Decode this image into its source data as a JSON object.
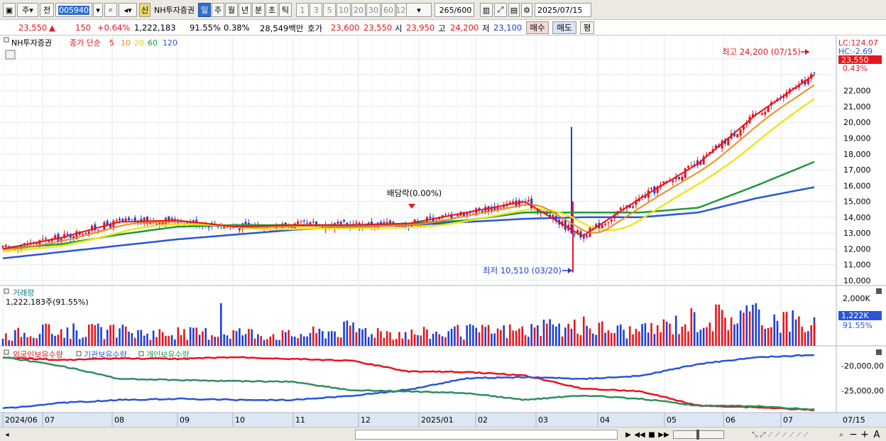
{
  "toolbar": {
    "menu_icon": "window-icon",
    "type_label": "주",
    "prev_label": "전",
    "code_value": "005940",
    "stock_name": "NH투자증권",
    "new_badge": "신",
    "periods": [
      "일",
      "주",
      "월",
      "년",
      "분",
      "초",
      "틱"
    ],
    "active_period": "일",
    "intervals": [
      "1",
      "3",
      "5",
      "10",
      "20",
      "30",
      "60",
      "120"
    ],
    "count": "265",
    "total": "/600",
    "date_value": "2025/07/15"
  },
  "quote": {
    "price": "23,550",
    "change_arrow": "▲",
    "change": "150",
    "change_pct": "+0.64%",
    "volume": "1,222,183",
    "volume_ratio": "91.55%",
    "turnover": "0.38%",
    "amount": "28,549백만",
    "ask_label": "호가",
    "ask": "23,600",
    "bid": "23,550",
    "open_label": "시",
    "open": "23,950",
    "high_label": "고",
    "high": "24,200",
    "low_label": "저",
    "low": "23,100",
    "buy_label": "매수",
    "sell_label": "매도",
    "eval_label": "평"
  },
  "price_panel": {
    "legend_name": "NH투자증권",
    "legend_ma_label": "종가 단순",
    "ma_periods": [
      "5",
      "10",
      "20",
      "60",
      "120"
    ],
    "ma_colors": [
      "#e8141c",
      "#f08c1c",
      "#f0e61c",
      "#1f9a3a",
      "#2a55d8"
    ],
    "axis_labels": [
      "22,000",
      "21,000",
      "20,000",
      "19,000",
      "18,000",
      "17,000",
      "16,000",
      "15,000",
      "14,000",
      "13,000",
      "12,000",
      "11,000",
      "10,000"
    ],
    "lc": "LC:124.07",
    "hc": "HC:-2.69",
    "last_price_tag": "23,550",
    "last_pct": "0.43%",
    "high_note": "최고 24,200 (07/15)",
    "low_note": "최저 10,510 (03/20)",
    "dividend_note": "배당락(0.00%)"
  },
  "volume_panel": {
    "title": "거래량",
    "value_note": "1,222,183주(91.55%)",
    "axis_label": "2,000K",
    "tag": "1,222K",
    "tag_pct": "91.55%"
  },
  "holding_panel": {
    "series": [
      {
        "name": "외국인보유수량",
        "color": "#e8141c"
      },
      {
        "name": "기관보유수량",
        "color": "#2a55d8"
      },
      {
        "name": "개인보유수량",
        "color": "#2f8f5a"
      }
    ],
    "axis_labels": [
      "-20,000,00",
      "-25,000,00"
    ]
  },
  "x_axis": {
    "labels": [
      "2024/06",
      "07",
      "08",
      "09",
      "10",
      "11",
      "12",
      "2025/01",
      "02",
      "03",
      "04",
      "05",
      "06",
      "07"
    ],
    "right_label": "07/15"
  },
  "chart_data": [
    {
      "type": "line",
      "title": "NH투자증권",
      "ylim": [
        10000,
        24500
      ],
      "note": "candlestick price with simple moving averages",
      "x": [
        "2024/06",
        "07",
        "08",
        "09",
        "10",
        "11",
        "12",
        "2025/01",
        "02",
        "03",
        "04",
        "05",
        "06",
        "07",
        "07/15"
      ],
      "series": [
        {
          "name": "5",
          "values": [
            12000,
            12700,
            13700,
            13800,
            13400,
            13500,
            13500,
            13600,
            14300,
            15000,
            12800,
            15200,
            17400,
            20500,
            23000
          ]
        },
        {
          "name": "60",
          "values": [
            12000,
            12300,
            12900,
            13400,
            13500,
            13500,
            13500,
            13600,
            13800,
            14300,
            14300,
            14300,
            14600,
            16000,
            17500
          ]
        },
        {
          "name": "120",
          "values": [
            11400,
            11800,
            12200,
            12600,
            12900,
            13200,
            13400,
            13500,
            13700,
            13900,
            14000,
            14000,
            14300,
            15200,
            15900
          ]
        }
      ]
    },
    {
      "type": "bar",
      "title": "거래량",
      "ylim": [
        0,
        2200
      ],
      "ylabel": "K",
      "categories": [
        "2024/06",
        "07",
        "08",
        "09",
        "10",
        "11",
        "12",
        "2025/01",
        "02",
        "03",
        "04",
        "05",
        "06",
        "07",
        "07/15"
      ],
      "values": [
        600,
        900,
        800,
        700,
        800,
        600,
        1000,
        700,
        800,
        900,
        1100,
        800,
        1600,
        1800,
        1222
      ]
    },
    {
      "type": "line",
      "title": "보유수량",
      "x": [
        "2024/06",
        "07",
        "08",
        "09",
        "10",
        "11",
        "12",
        "2025/01",
        "02",
        "03",
        "04",
        "05",
        "06",
        "07",
        "07/15"
      ],
      "series": [
        {
          "name": "외국인보유수량",
          "values": [
            -19000000,
            -19500000,
            -19200000,
            -19300000,
            -19000000,
            -19300000,
            -19600000,
            -21500000,
            -21600000,
            -22200000,
            -24500000,
            -25000000,
            -27500000,
            -27800000,
            -28300000
          ]
        },
        {
          "name": "기관보유수량",
          "values": [
            -28000000,
            -27000000,
            -26500000,
            -26300000,
            -26500000,
            -26500000,
            -25800000,
            -24700000,
            -22700000,
            -22500000,
            -22800000,
            -22300000,
            -20200000,
            -19000000,
            -18600000
          ]
        },
        {
          "name": "개인보유수량",
          "values": [
            -19000000,
            -20500000,
            -22800000,
            -23000000,
            -23200000,
            -23300000,
            -24800000,
            -25000000,
            -25300000,
            -26500000,
            -25700000,
            -26300000,
            -27500000,
            -27600000,
            -28200000
          ]
        }
      ]
    }
  ],
  "scrollbar": {
    "icons": [
      "play-icon",
      "rewind-icon",
      "stop-icon",
      "fast-forward-icon",
      "zoom-out-icon",
      "zoom-in-icon"
    ],
    "zoom_minus": "−",
    "zoom_plus": "+",
    "font_label": "A"
  }
}
